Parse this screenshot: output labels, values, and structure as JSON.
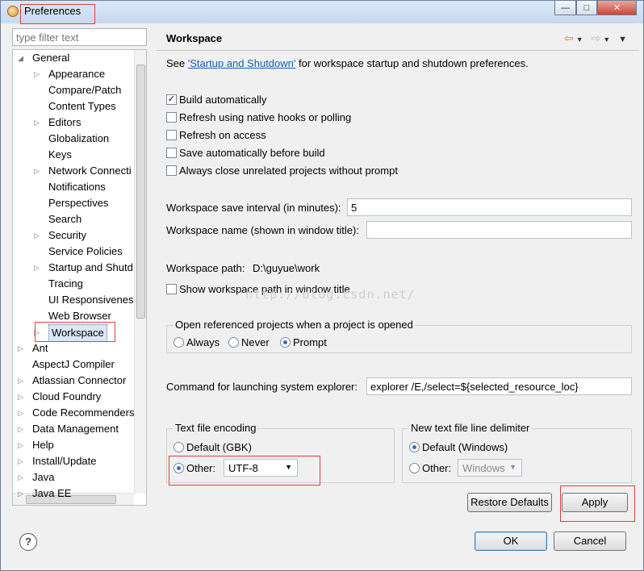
{
  "window": {
    "title": "Preferences",
    "minimize_glyph": "—",
    "maximize_glyph": "□",
    "close_glyph": "✕"
  },
  "filter": {
    "placeholder": "type filter text"
  },
  "tree": {
    "items": [
      {
        "label": "General",
        "level": 0,
        "arrow": "expanded"
      },
      {
        "label": "Appearance",
        "level": 1,
        "arrow": "collapsed"
      },
      {
        "label": "Compare/Patch",
        "level": 1,
        "arrow": "none"
      },
      {
        "label": "Content Types",
        "level": 1,
        "arrow": "none"
      },
      {
        "label": "Editors",
        "level": 1,
        "arrow": "collapsed"
      },
      {
        "label": "Globalization",
        "level": 1,
        "arrow": "none"
      },
      {
        "label": "Keys",
        "level": 1,
        "arrow": "none"
      },
      {
        "label": "Network Connecti",
        "level": 1,
        "arrow": "collapsed"
      },
      {
        "label": "Notifications",
        "level": 1,
        "arrow": "none"
      },
      {
        "label": "Perspectives",
        "level": 1,
        "arrow": "none"
      },
      {
        "label": "Search",
        "level": 1,
        "arrow": "none"
      },
      {
        "label": "Security",
        "level": 1,
        "arrow": "collapsed"
      },
      {
        "label": "Service Policies",
        "level": 1,
        "arrow": "none"
      },
      {
        "label": "Startup and Shutd",
        "level": 1,
        "arrow": "collapsed"
      },
      {
        "label": "Tracing",
        "level": 1,
        "arrow": "none"
      },
      {
        "label": "UI Responsivenes",
        "level": 1,
        "arrow": "none"
      },
      {
        "label": "Web Browser",
        "level": 1,
        "arrow": "none"
      },
      {
        "label": "Workspace",
        "level": 1,
        "arrow": "collapsed",
        "selected": true
      },
      {
        "label": "Ant",
        "level": 0,
        "arrow": "collapsed"
      },
      {
        "label": "AspectJ Compiler",
        "level": 0,
        "arrow": "none"
      },
      {
        "label": "Atlassian Connector",
        "level": 0,
        "arrow": "collapsed"
      },
      {
        "label": "Cloud Foundry",
        "level": 0,
        "arrow": "collapsed"
      },
      {
        "label": "Code Recommenders",
        "level": 0,
        "arrow": "collapsed"
      },
      {
        "label": "Data Management",
        "level": 0,
        "arrow": "collapsed"
      },
      {
        "label": "Help",
        "level": 0,
        "arrow": "collapsed"
      },
      {
        "label": "Install/Update",
        "level": 0,
        "arrow": "collapsed"
      },
      {
        "label": "Java",
        "level": 0,
        "arrow": "collapsed"
      },
      {
        "label": "Java EE",
        "level": 0,
        "arrow": "collapsed"
      }
    ]
  },
  "page": {
    "title": "Workspace",
    "nav_back": "⇦",
    "nav_forward": "⇨",
    "nav_menu": "▼",
    "see_prefix": "See ",
    "see_link": "'Startup and Shutdown'",
    "see_suffix": " for workspace startup and shutdown preferences.",
    "checkboxes": [
      {
        "label": "Build automatically",
        "checked": true
      },
      {
        "label": "Refresh using native hooks or polling",
        "checked": false
      },
      {
        "label": "Refresh on access",
        "checked": false
      },
      {
        "label": "Save automatically before build",
        "checked": false
      },
      {
        "label": "Always close unrelated projects without prompt",
        "checked": false
      }
    ],
    "save_interval_label": "Workspace save interval (in minutes):",
    "save_interval_value": "5",
    "workspace_name_label": "Workspace name (shown in window title):",
    "workspace_name_value": "",
    "workspace_path_label": "Workspace path:",
    "workspace_path_value": "D:\\guyue\\work",
    "show_path_label": "Show workspace path in window title",
    "open_ref_group": "Open referenced projects when a project is opened",
    "open_ref_options": [
      "Always",
      "Never",
      "Prompt"
    ],
    "open_ref_selected": "Prompt",
    "command_label": "Command for launching system explorer:",
    "command_value": "explorer /E,/select=${selected_resource_loc}",
    "encoding_group": "Text file encoding",
    "encoding_default": "Default (GBK)",
    "encoding_other": "Other:",
    "encoding_other_value": "UTF-8",
    "delimiter_group": "New text file line delimiter",
    "delimiter_default": "Default (Windows)",
    "delimiter_other": "Other:",
    "delimiter_other_value": "Windows",
    "restore_defaults": "Restore Defaults",
    "apply": "Apply",
    "watermark": "http://blog.csdn.net/"
  },
  "footer": {
    "help": "?",
    "ok": "OK",
    "cancel": "Cancel"
  },
  "colors": {
    "link": "#1c5bb2",
    "highlight_box": "#e0403c",
    "accent": "#2f6fc4"
  }
}
